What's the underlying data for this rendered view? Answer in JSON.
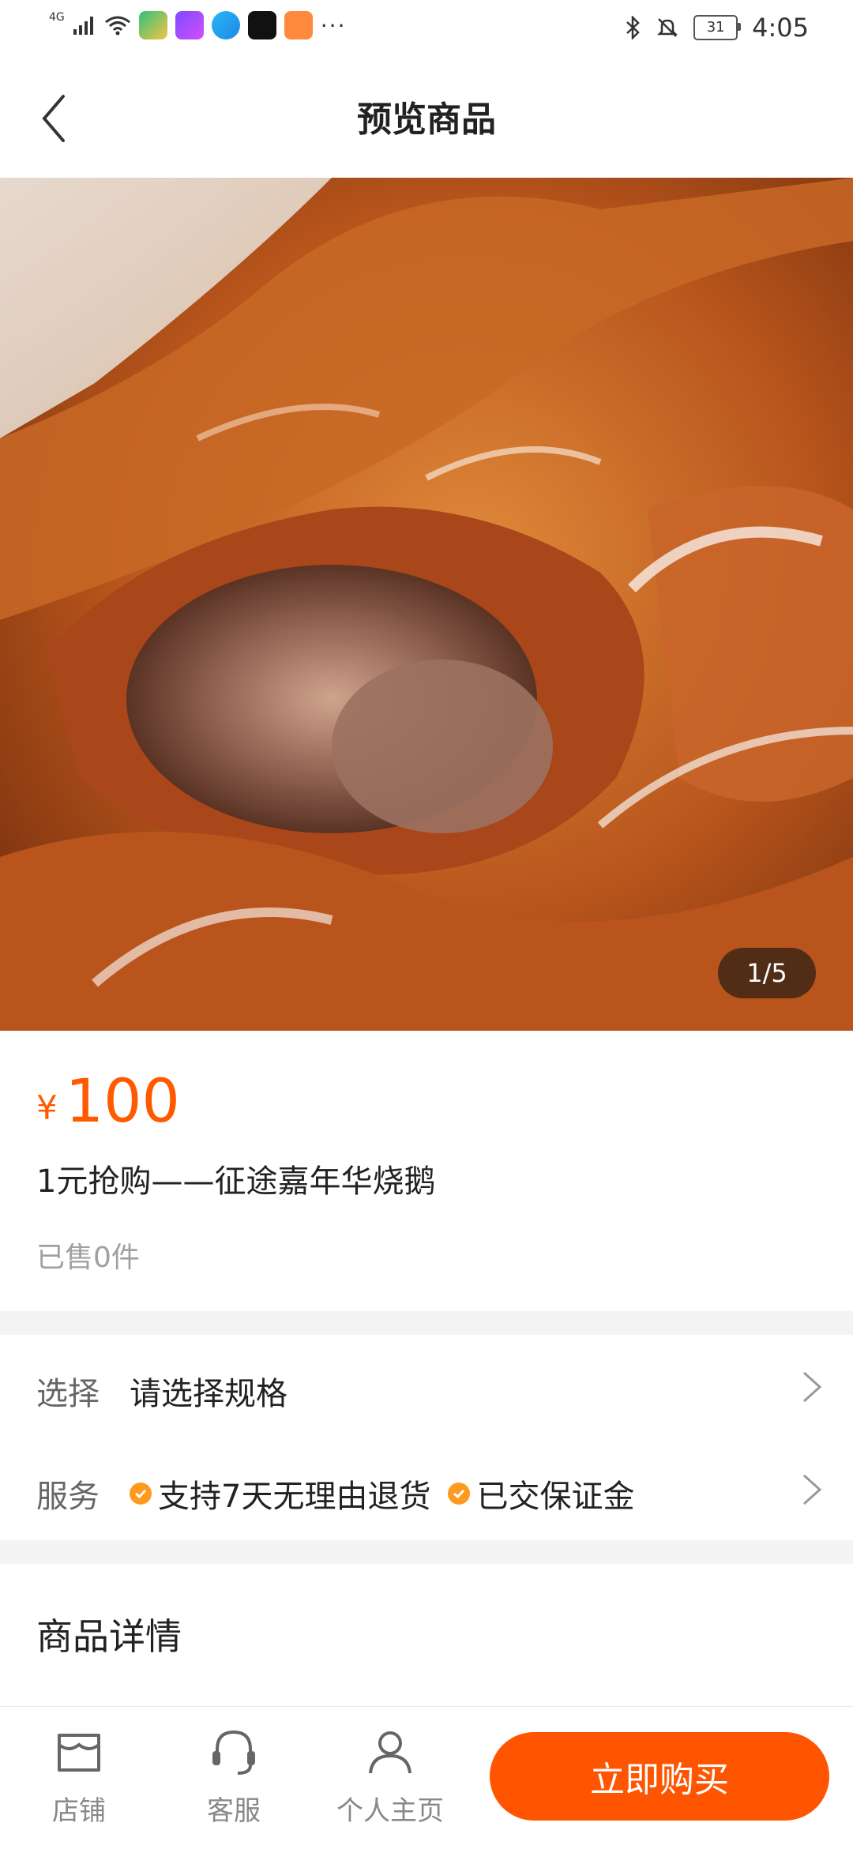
{
  "status": {
    "network": "4G",
    "time": "4:05",
    "battery": "31",
    "more": "···"
  },
  "header": {
    "title": "预览商品"
  },
  "gallery": {
    "pager": "1/5"
  },
  "product": {
    "currency": "¥",
    "price": "100",
    "name": "1元抢购——征途嘉年华烧鹅",
    "sold": "已售0件"
  },
  "options": {
    "select_label": "选择",
    "select_value": "请选择规格",
    "service_label": "服务",
    "service_items": [
      "支持7天无理由退货",
      "已交保证金"
    ]
  },
  "details": {
    "title": "商品详情"
  },
  "bottom": {
    "shop": "店铺",
    "service": "客服",
    "profile": "个人主页",
    "buy": "立即购买"
  },
  "colors": {
    "accent": "#ff5400",
    "badge": "#ff9a1f"
  }
}
